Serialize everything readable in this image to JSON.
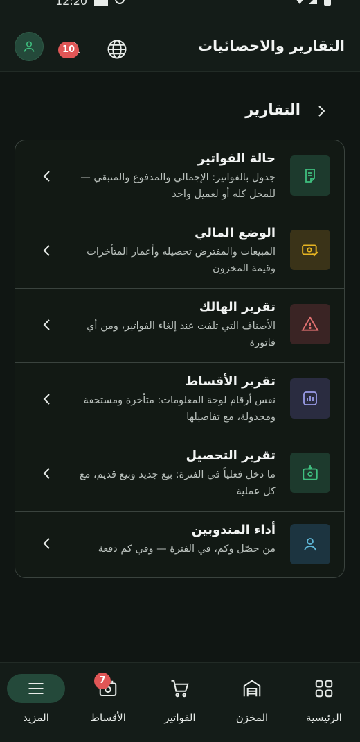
{
  "status": {
    "time": "12:20"
  },
  "header": {
    "title": "التقارير والاحصائيات",
    "notifications_count": "10",
    "icons": [
      "user-icon",
      "bell-icon",
      "globe-icon"
    ]
  },
  "section": {
    "title": "التقارير"
  },
  "reports": [
    {
      "title": "حالة الفواتير",
      "desc": "جدول بالفواتير: الإجمالي والمدفوع والمتبقي — للمحل كله أو لعميل واحد",
      "icon": "invoice-icon",
      "color": "#3fbf7f",
      "bg": "#1d3a2d"
    },
    {
      "title": "الوضع المالي",
      "desc": "المبيعات والمفترض تحصيله وأعمار المتأخرات وقيمة المخزون",
      "icon": "money-icon",
      "color": "#e6b422",
      "bg": "#3a3318"
    },
    {
      "title": "تقرير الهالك",
      "desc": "الأصناف التي تلفت عند إلغاء الفواتير، ومن أي فاتورة",
      "icon": "warning-icon",
      "color": "#e07070",
      "bg": "#3a2424"
    },
    {
      "title": "تقرير الأقساط",
      "desc": "نفس أرقام لوحة المعلومات: متأخرة ومستحقة ومجدولة، مع تفاصيلها",
      "icon": "chart-icon",
      "color": "#9a9be6",
      "bg": "#2a2c40"
    },
    {
      "title": "تقرير التحصيل",
      "desc": "ما دخل فعلياً في الفترة: بيع جديد وبيع قديم، مع كل عملية",
      "icon": "cash-in-icon",
      "color": "#3fbf7f",
      "bg": "#1d3a2d"
    },
    {
      "title": "أداء المندوبين",
      "desc": "من حصّل وكم، في الفترة — وفي كم دفعة",
      "icon": "person-icon",
      "color": "#5fb8d8",
      "bg": "#1c3440"
    }
  ],
  "nav": [
    {
      "label": "الرئيسية",
      "icon": "grid-icon",
      "active": false
    },
    {
      "label": "المخزن",
      "icon": "warehouse-icon",
      "active": false
    },
    {
      "label": "الفواتير",
      "icon": "cart-icon",
      "active": false
    },
    {
      "label": "الأقساط",
      "icon": "installments-icon",
      "active": false,
      "badge": "7"
    },
    {
      "label": "المزيد",
      "icon": "menu-icon",
      "active": true
    }
  ]
}
